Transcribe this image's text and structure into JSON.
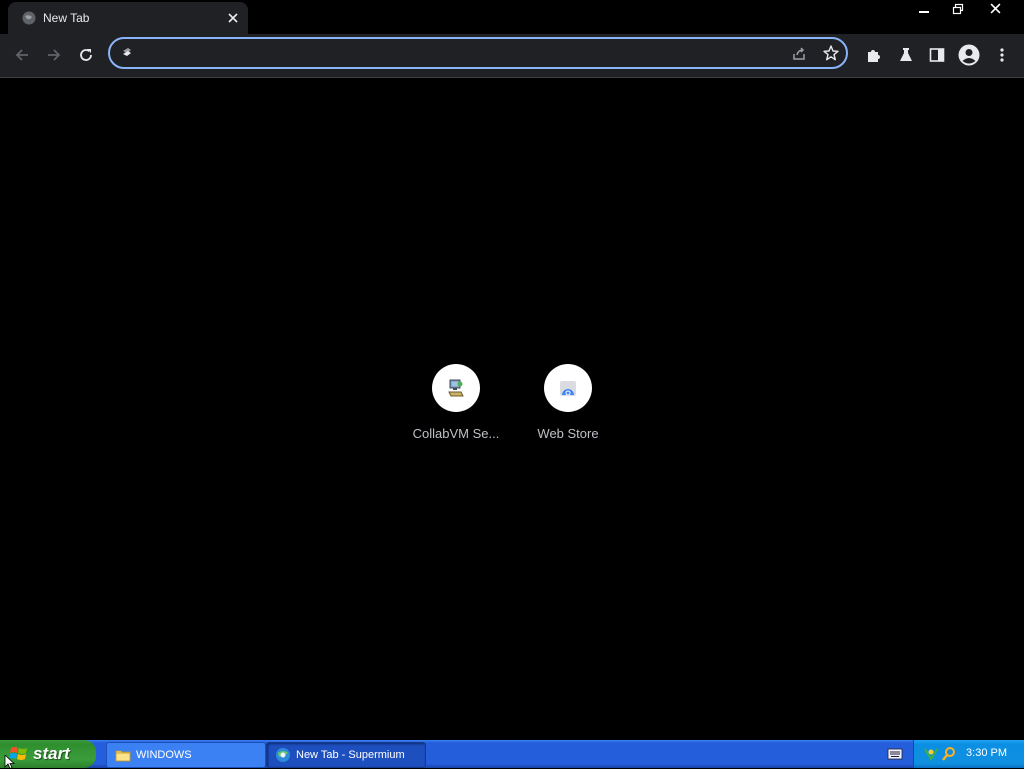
{
  "tab": {
    "title": "New Tab",
    "close_glyph": "✕"
  },
  "window_controls": {
    "minimize": "—",
    "restore": "❐",
    "close": "✕"
  },
  "toolbar": {
    "back_icon": "back-arrow-icon",
    "forward_icon": "forward-arrow-icon",
    "reload_icon": "reload-icon",
    "omnibox": {
      "value": "",
      "placeholder": ""
    }
  },
  "shortcuts": [
    {
      "label": "CollabVM Se...",
      "icon": "computer-icon"
    },
    {
      "label": "Web Store",
      "icon": "web-store-icon"
    }
  ],
  "taskbar": {
    "start_label": "start",
    "items": [
      {
        "label": "WINDOWS",
        "icon": "folder-icon",
        "active": false
      },
      {
        "label": "New Tab - Supermium",
        "icon": "browser-icon",
        "active": true
      }
    ],
    "clock": "3:30 PM"
  },
  "colors": {
    "accent": "#8ab4f8",
    "chrome_bg": "#202124",
    "taskbar_blue": "#245edb",
    "start_green": "#3a9d3a"
  }
}
